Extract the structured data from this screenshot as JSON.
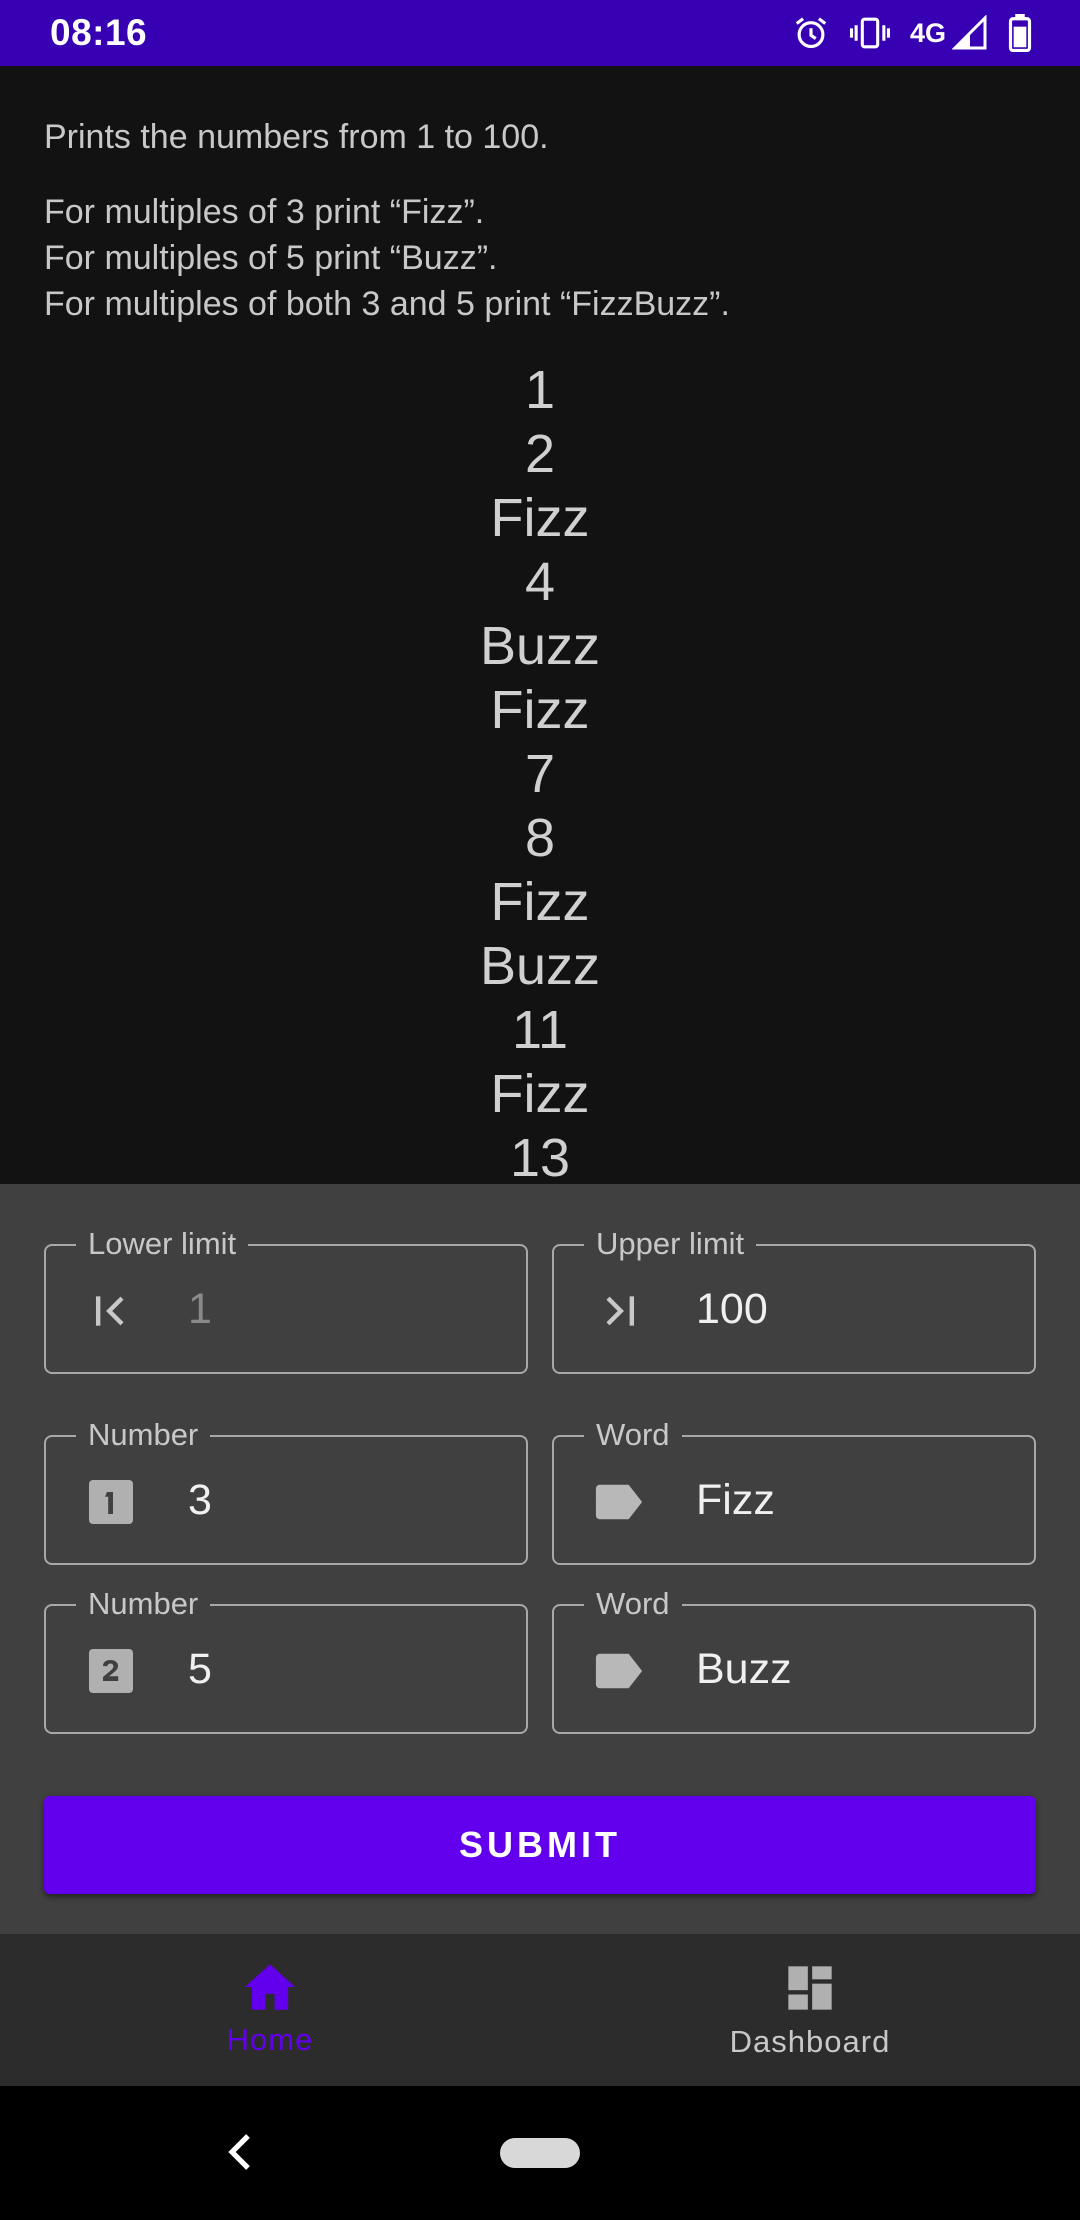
{
  "status_bar": {
    "time": "08:16",
    "network": "4G",
    "icons": [
      "alarm-icon",
      "vibrate-icon",
      "signal-icon",
      "battery-icon"
    ]
  },
  "description": {
    "intro": "Prints the numbers from 1 to 100.",
    "rules": [
      "For multiples of 3 print “Fizz”.",
      "For multiples of 5 print “Buzz”.",
      "For multiples of both 3 and 5 print “FizzBuzz”."
    ]
  },
  "output": [
    "1",
    "2",
    "Fizz",
    "4",
    "Buzz",
    "Fizz",
    "7",
    "8",
    "Fizz",
    "Buzz",
    "11",
    "Fizz",
    "13"
  ],
  "form": {
    "lower_limit": {
      "label": "Lower limit",
      "placeholder": "1",
      "icon": "first-page-icon"
    },
    "upper_limit": {
      "label": "Upper limit",
      "value": "100",
      "icon": "last-page-icon"
    },
    "rule1": {
      "number": {
        "label": "Number",
        "value": "3",
        "icon": "looks-one-icon"
      },
      "word": {
        "label": "Word",
        "value": "Fizz",
        "icon": "label-icon"
      }
    },
    "rule2": {
      "number": {
        "label": "Number",
        "value": "5",
        "icon": "looks-two-icon"
      },
      "word": {
        "label": "Word",
        "value": "Buzz",
        "icon": "label-icon"
      }
    },
    "submit_label": "SUBMIT"
  },
  "bottom_nav": {
    "items": [
      {
        "label": "Home",
        "icon": "home-icon",
        "active": true
      },
      {
        "label": "Dashboard",
        "icon": "dashboard-icon",
        "active": false
      }
    ]
  },
  "colors": {
    "status_bar": "#3700b3",
    "accent": "#6200ee",
    "background": "#121212",
    "panel": "#404040",
    "bottom_nav": "#2c2c2c"
  }
}
